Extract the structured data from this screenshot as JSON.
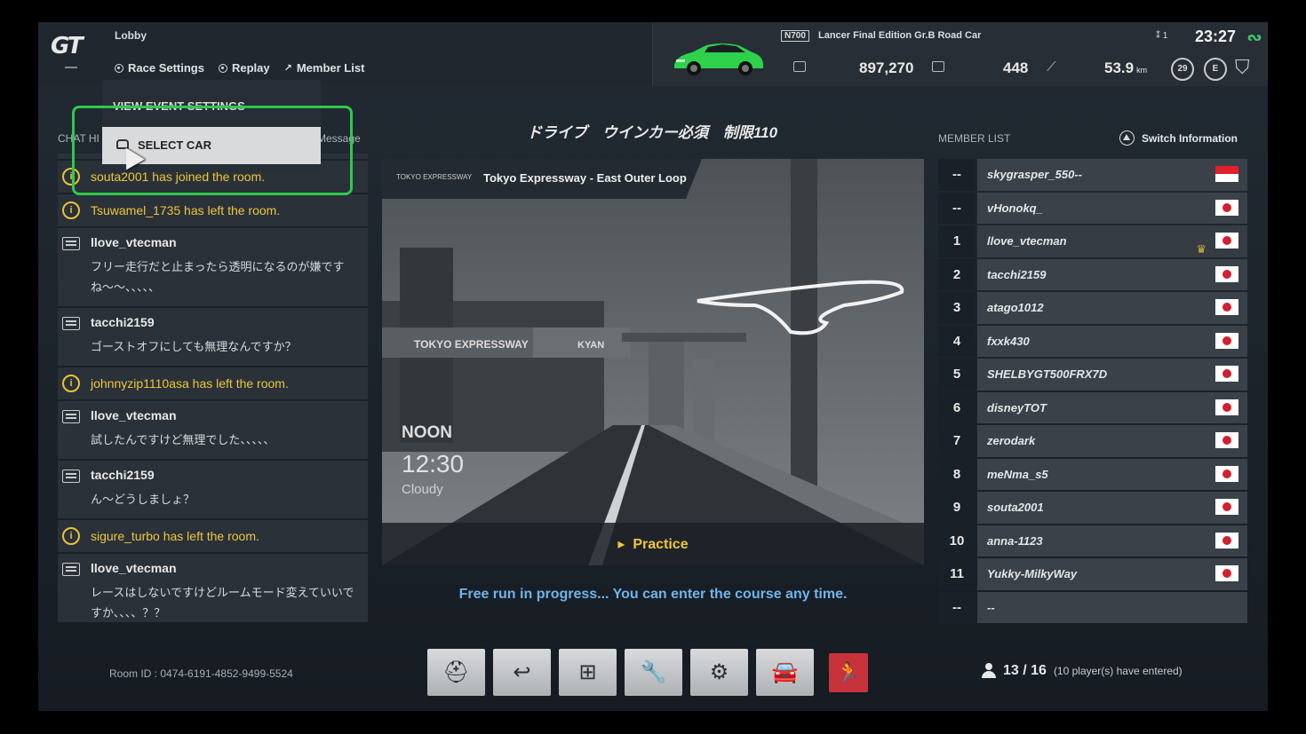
{
  "header": {
    "lobby_label": "Lobby",
    "tabs": [
      {
        "label": "Race Settings"
      },
      {
        "label": "Replay"
      },
      {
        "label": "Member List"
      }
    ]
  },
  "car": {
    "class_badge": "N700",
    "name": "Lancer Final Edition Gr.B Road Car",
    "pp": "897,270",
    "power": "448",
    "distance": "53.9",
    "distance_unit": "km",
    "round_badge": "29",
    "players_mini": "1",
    "clock": "23:27",
    "accent_color": "#3fc36a"
  },
  "chat": {
    "header_left": "CHAT HI",
    "header_right": "Message",
    "items": [
      {
        "type": "info",
        "text": "souta2001 has joined the room."
      },
      {
        "type": "info",
        "text": "Tsuwamel_1735 has left the room."
      },
      {
        "type": "msg",
        "user": "llove_vtecman",
        "text": "フリー走行だと止まったら透明になるのが嫌ですね〜〜、、、、、"
      },
      {
        "type": "msg",
        "user": "tacchi2159",
        "text": "ゴーストオフにしても無理なんですか？"
      },
      {
        "type": "info",
        "text": "johnnyzip1110asa has left the room."
      },
      {
        "type": "msg",
        "user": "llove_vtecman",
        "text": "試したんですけど無理でした、、、、、"
      },
      {
        "type": "msg",
        "user": "tacchi2159",
        "text": "ん〜どうしましょ？"
      },
      {
        "type": "info",
        "text": "sigure_turbo has left the room."
      },
      {
        "type": "msg",
        "user": "llove_vtecman",
        "text": "レースはしないですけどルームモード変えていいですか、、、、？？"
      }
    ]
  },
  "dropdown": {
    "view_event": "VIEW EVENT SETTINGS",
    "select_car": "SELECT CAR"
  },
  "event": {
    "title": "ドライブ　ウインカー必須　制限110",
    "track_logo": "TOKYO EXPRESSWAY",
    "track_name": "Tokyo Expressway - East Outer Loop",
    "sign_text_1": "TOKYO EXPRESSWAY",
    "sign_text_2": "KYAN",
    "time_of_day": "NOON",
    "time": "12:30",
    "weather": "Cloudy",
    "mode": "Practice",
    "status": "Free run in progress... You can enter the course any time."
  },
  "members": {
    "header": "MEMBER LIST",
    "switch_label": "Switch Information",
    "rows": [
      {
        "num": "--",
        "name": "skygrasper_550--",
        "flag": "sg"
      },
      {
        "num": "--",
        "name": "vHonokq_",
        "flag": "jp"
      },
      {
        "num": "1",
        "name": "llove_vtecman",
        "flag": "jp",
        "host": true
      },
      {
        "num": "2",
        "name": "tacchi2159",
        "flag": "jp"
      },
      {
        "num": "3",
        "name": "atago1012",
        "flag": "jp"
      },
      {
        "num": "4",
        "name": "fxxk430",
        "flag": "jp"
      },
      {
        "num": "5",
        "name": "SHELBYGT500FRX7D",
        "flag": "jp"
      },
      {
        "num": "6",
        "name": "disneyTOT",
        "flag": "jp"
      },
      {
        "num": "7",
        "name": "zerodark",
        "flag": "jp"
      },
      {
        "num": "8",
        "name": "meNma_s5",
        "flag": "jp"
      },
      {
        "num": "9",
        "name": "souta2001",
        "flag": "jp"
      },
      {
        "num": "10",
        "name": "anna-1123",
        "flag": "jp"
      },
      {
        "num": "11",
        "name": "Yukky-MilkyWay",
        "flag": "jp"
      },
      {
        "num": "--",
        "name": "--",
        "flag": ""
      }
    ]
  },
  "footer": {
    "room_id": "Room ID : 0474-6191-4852-9499-5524",
    "player_count": "13 / 16",
    "player_note": "(10 player(s) have entered)",
    "actions": [
      {
        "name": "ready-button",
        "icon": "helmet-check-icon",
        "glyph": "⛑"
      },
      {
        "name": "return-button",
        "icon": "return-icon",
        "glyph": "↩"
      },
      {
        "name": "spectate-button",
        "icon": "binoculars-icon",
        "glyph": "⊞"
      },
      {
        "name": "tuning-button",
        "icon": "wrench-icon",
        "glyph": "🔧"
      },
      {
        "name": "settings-button",
        "icon": "gear-icon",
        "glyph": "⚙"
      },
      {
        "name": "garage-button",
        "icon": "car-icon",
        "glyph": "🚘"
      },
      {
        "name": "exit-button",
        "icon": "exit-icon",
        "glyph": "🏃"
      }
    ]
  }
}
